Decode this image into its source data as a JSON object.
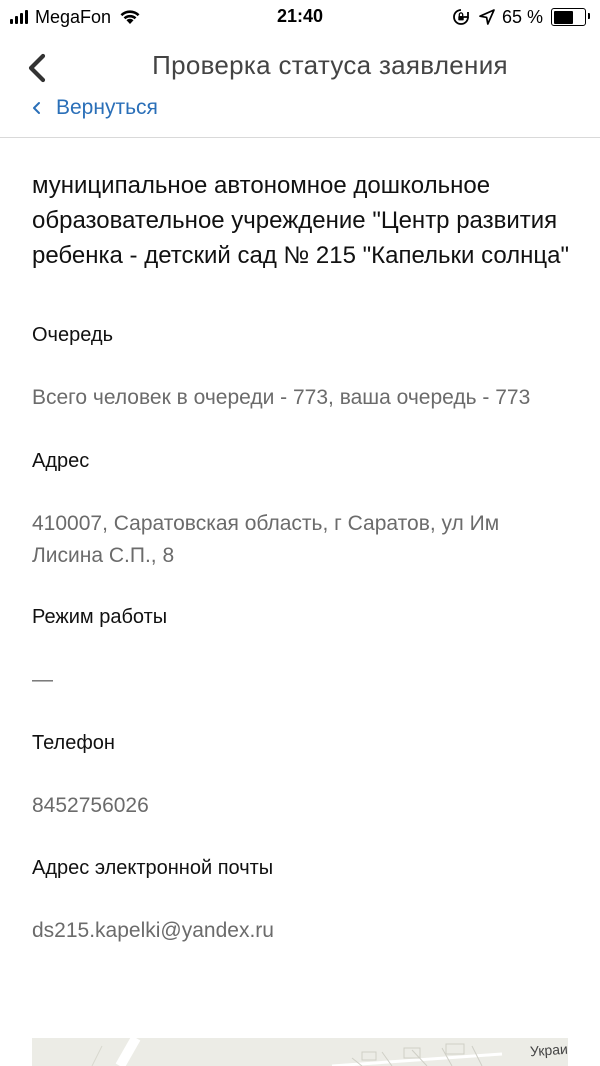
{
  "status_bar": {
    "carrier": "MegaFon",
    "time": "21:40",
    "battery_percent": "65 %",
    "battery_level": 0.65,
    "icons": [
      "signal-bars-icon",
      "wifi-icon",
      "rotation-lock-icon",
      "location-arrow-icon",
      "battery-icon"
    ]
  },
  "nav": {
    "title": "Проверка статуса заявления",
    "back_link": "Вернуться"
  },
  "content": {
    "org_name": "муниципальное автономное дошкольное образовательное учреждение \"Центр развития ребенка - детский сад № 215 \"Капельки солнца\"",
    "sections": [
      {
        "label": "Очередь",
        "value": "Всего человек в очереди - 773, ваша очередь - 773"
      },
      {
        "label": "Адрес",
        "value": "410007, Саратовская область, г Саратов, ул Им Лисина С.П., 8"
      },
      {
        "label": "Режим работы",
        "value": "—"
      },
      {
        "label": "Телефон",
        "value": "8452756026"
      },
      {
        "label": "Адрес электронной почты",
        "value": "ds215.kapelki@yandex.ru"
      }
    ]
  },
  "map": {
    "street_label": "Украи"
  },
  "colors": {
    "link": "#2a6fb8",
    "value_text": "#6b6b6b",
    "title_text": "#444444"
  }
}
